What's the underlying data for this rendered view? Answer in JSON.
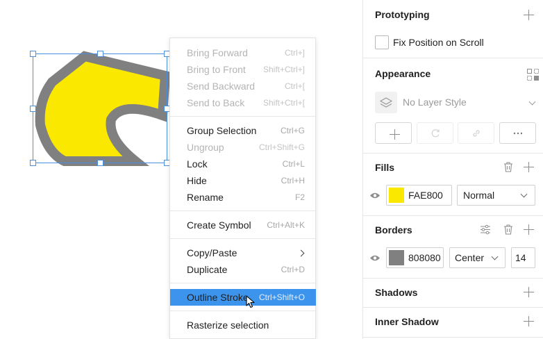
{
  "context_menu": {
    "items": [
      {
        "label": "Bring Forward",
        "shortcut": "Ctrl+]"
      },
      {
        "label": "Bring to Front",
        "shortcut": "Shift+Ctrl+]"
      },
      {
        "label": "Send Backward",
        "shortcut": "Ctrl+["
      },
      {
        "label": "Send to Back",
        "shortcut": "Shift+Ctrl+["
      },
      {
        "label": "Group Selection",
        "shortcut": "Ctrl+G"
      },
      {
        "label": "Ungroup",
        "shortcut": "Ctrl+Shift+G"
      },
      {
        "label": "Lock",
        "shortcut": "Ctrl+L"
      },
      {
        "label": "Hide",
        "shortcut": "Ctrl+H"
      },
      {
        "label": "Rename",
        "shortcut": "F2"
      },
      {
        "label": "Create Symbol",
        "shortcut": "Ctrl+Alt+K"
      },
      {
        "label": "Copy/Paste",
        "shortcut": ""
      },
      {
        "label": "Duplicate",
        "shortcut": "Ctrl+D"
      },
      {
        "label": "Outline Stroke",
        "shortcut": "Ctrl+Shift+O"
      },
      {
        "label": "Rasterize selection",
        "shortcut": ""
      }
    ]
  },
  "panel": {
    "prototyping": {
      "title": "Prototyping",
      "fix_position_label": "Fix Position on Scroll"
    },
    "appearance": {
      "title": "Appearance",
      "layer_style": "No Layer Style"
    },
    "fills": {
      "title": "Fills",
      "hex": "FAE800",
      "color": "#FAE800",
      "blend": "Normal"
    },
    "borders": {
      "title": "Borders",
      "hex": "808080",
      "color": "#808080",
      "position": "Center",
      "width": "14"
    },
    "shadows": {
      "title": "Shadows"
    },
    "inner_shadow": {
      "title": "Inner Shadow"
    }
  },
  "colors": {
    "accent": "#3C94EC",
    "fill": "#FAE800",
    "stroke": "#808080",
    "selection": "#4A90E2"
  },
  "icons": [
    "plus-icon",
    "layer-style-icon",
    "eye-icon",
    "trash-icon",
    "sliders-icon",
    "refresh-icon",
    "link-icon",
    "more-icon",
    "chevron-down-icon",
    "chevron-right-icon",
    "cursor-icon"
  ]
}
